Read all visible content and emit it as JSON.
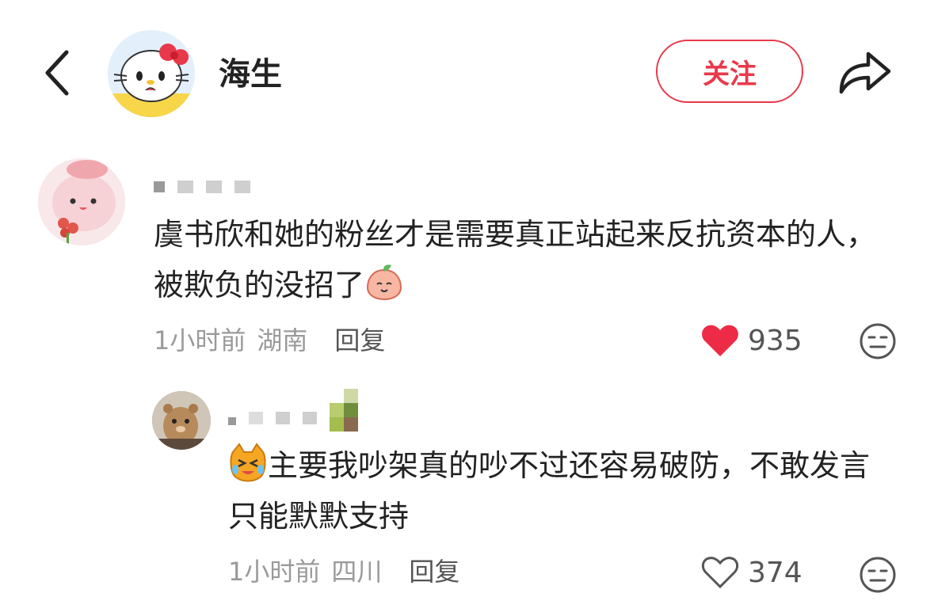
{
  "header": {
    "author_name": "海生",
    "follow_label": "关注",
    "icons": {
      "back": "back-chevron-icon",
      "share": "share-arrow-icon"
    }
  },
  "comments": [
    {
      "text": "虞书欣和她的粉丝才是需要真正站起来反抗资本的人，被欺负的没招了",
      "emoji": "peach-face-emoji",
      "time": "1小时前",
      "location": "湖南",
      "reply_label": "回复",
      "likes": "935",
      "liked": true
    },
    {
      "emoji": "crying-cat-emoji",
      "text": "主要我吵架真的吵不过还容易破防，不敢发言只能默默支持",
      "time": "1小时前",
      "location": "四川",
      "reply_label": "回复",
      "likes": "374",
      "liked": false
    }
  ],
  "colors": {
    "accent": "#e8394a",
    "meta_gray": "#9a9a9a",
    "text": "#222222"
  }
}
